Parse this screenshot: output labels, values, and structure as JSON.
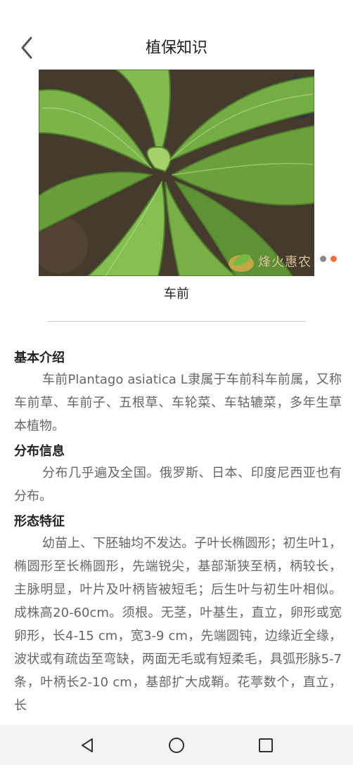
{
  "header": {
    "title": "植保知识",
    "back_icon": "chevron-left-icon"
  },
  "carousel": {
    "watermark_text": "烽火惠农",
    "active_index": 1,
    "dot_count": 2,
    "colors": {
      "inactive": "#8a8a8a",
      "active": "#f0703c"
    }
  },
  "plant": {
    "name": "车前"
  },
  "sections": [
    {
      "title": "基本介绍",
      "body": "车前Plantago asiatica L隶属于车前科车前属，又称车前草、车前子、五根草、车轮菜、车轱辘菜，多年生草本植物。"
    },
    {
      "title": "分布信息",
      "body": "分布几乎遍及全国。俄罗斯、日本、印度尼西亚也有分布。"
    },
    {
      "title": "形态特征",
      "body": "幼苗上、下胚轴均不发达。子叶长椭圆形；初生叶1，椭圆形至长椭圆形，先端锐尖，基部渐狭至柄，柄较长，主脉明显，叶片及叶柄皆被短毛；后生叶与初生叶相似。成株高20-60cm。须根。无茎，叶基生，直立，卵形或宽卵形，长4-15 cm，宽3-9 cm，先端圆钝，边缘近全缘，波状或有疏齿至弯缺，两面无毛或有短柔毛，具弧形脉5-7条，叶柄长2-10 cm，基部扩大成鞘。花葶数个，直立，长"
    }
  ],
  "nav": {
    "back": "triangle-back-icon",
    "home": "circle-home-icon",
    "recents": "square-recents-icon"
  }
}
